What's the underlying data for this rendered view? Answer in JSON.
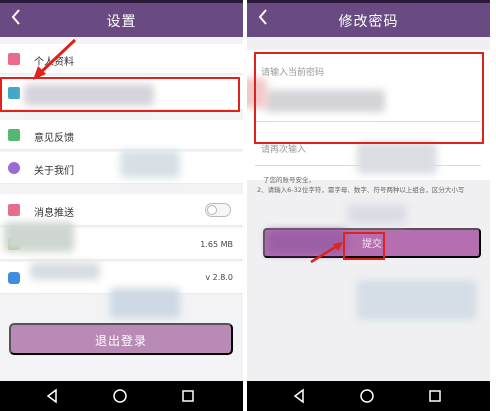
{
  "left": {
    "title": "设置",
    "items": [
      {
        "label": "个人资料",
        "icon": "profile-icon",
        "color": "#e96a8c"
      },
      {
        "label": "",
        "icon": "lock-icon",
        "color": "#3fa7c8"
      },
      {
        "label": "意见反馈",
        "icon": "feedback-icon",
        "color": "#52b971"
      },
      {
        "label": "关于我们",
        "icon": "info-icon",
        "color": "#9b6bd3"
      },
      {
        "label": "消息推送",
        "icon": "message-icon",
        "color": "#e86d8a"
      },
      {
        "label": "",
        "value": "1.65 MB",
        "icon": "cache-icon",
        "color": "#8fbf5c"
      },
      {
        "label": "",
        "value": "v 2.8.0",
        "icon": "update-icon",
        "color": "#3f8de0"
      }
    ],
    "logout_label": "退出登录"
  },
  "right": {
    "title": "修改密码",
    "current_password_placeholder": "请输入当前密码",
    "confirm_password_placeholder": "请再次输入",
    "hint1": "了您的账号安全，",
    "hint2": "2、请输入6-32位字符，需字母、数字、符号两种以上组合，区分大小写",
    "submit_label": "提交"
  },
  "colors": {
    "titlebar": "#6a4a82",
    "logout_button": "#b98ab6",
    "submit_button": "#b56fb0",
    "annotation": "#e0211c"
  }
}
